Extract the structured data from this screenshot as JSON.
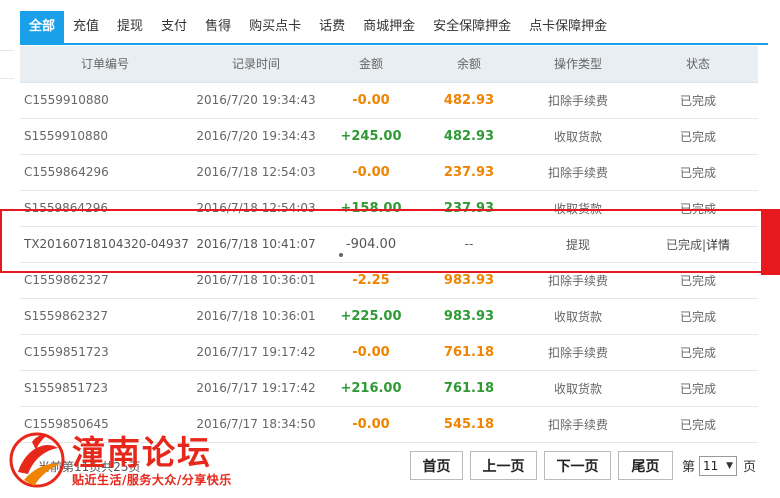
{
  "tabs": [
    "全部",
    "充值",
    "提现",
    "支付",
    "售得",
    "购买点卡",
    "话费",
    "商城押金",
    "安全保障押金",
    "点卡保障押金"
  ],
  "table": {
    "headers": [
      "订单编号",
      "记录时间",
      "金额",
      "余额",
      "操作类型",
      "状态"
    ],
    "rows": [
      {
        "order": "C1559910880",
        "time": "2016/7/20 19:34:43",
        "amount": "-0.00",
        "balance": "482.93",
        "type": "扣除手续费",
        "status": "已完成"
      },
      {
        "order": "S1559910880",
        "time": "2016/7/20 19:34:43",
        "amount": "+245.00",
        "balance": "482.93",
        "type": "收取货款",
        "status": "已完成"
      },
      {
        "order": "C1559864296",
        "time": "2016/7/18 12:54:03",
        "amount": "-0.00",
        "balance": "237.93",
        "type": "扣除手续费",
        "status": "已完成"
      },
      {
        "order": "S1559864296",
        "time": "2016/7/18 12:54:03",
        "amount": "+158.00",
        "balance": "237.93",
        "type": "收取货款",
        "status": "已完成"
      },
      {
        "order": "TX20160718104320-04937",
        "time": "2016/7/18 10:41:07",
        "amount": "-904.00",
        "balance": "--",
        "type": "提现",
        "status": "已完成",
        "detail": "详情"
      },
      {
        "order": "C1559862327",
        "time": "2016/7/18 10:36:01",
        "amount": "-2.25",
        "balance": "983.93",
        "type": "扣除手续费",
        "status": "已完成"
      },
      {
        "order": "S1559862327",
        "time": "2016/7/18 10:36:01",
        "amount": "+225.00",
        "balance": "983.93",
        "type": "收取货款",
        "status": "已完成"
      },
      {
        "order": "C1559851723",
        "time": "2016/7/17 19:17:42",
        "amount": "-0.00",
        "balance": "761.18",
        "type": "扣除手续费",
        "status": "已完成"
      },
      {
        "order": "S1559851723",
        "time": "2016/7/17 19:17:42",
        "amount": "+216.00",
        "balance": "761.18",
        "type": "收取货款",
        "status": "已完成"
      },
      {
        "order": "C1559850645",
        "time": "2016/7/17 18:34:50",
        "amount": "-0.00",
        "balance": "545.18",
        "type": "扣除手续费",
        "status": "已完成"
      }
    ]
  },
  "pager": {
    "info": "当前第11页共25页",
    "first": "首页",
    "prev": "上一页",
    "next": "下一页",
    "last": "尾页",
    "page_prefix": "第",
    "current_page": "11",
    "page_suffix": "页"
  },
  "watermark": {
    "title": "潼南论坛",
    "slogan": "贴近生活/服务大众/分享快乐"
  },
  "colors": {
    "accent": "#1aa0e8",
    "negative": "#f08300",
    "positive": "#2f9a35",
    "highlight": "#e8181f"
  }
}
